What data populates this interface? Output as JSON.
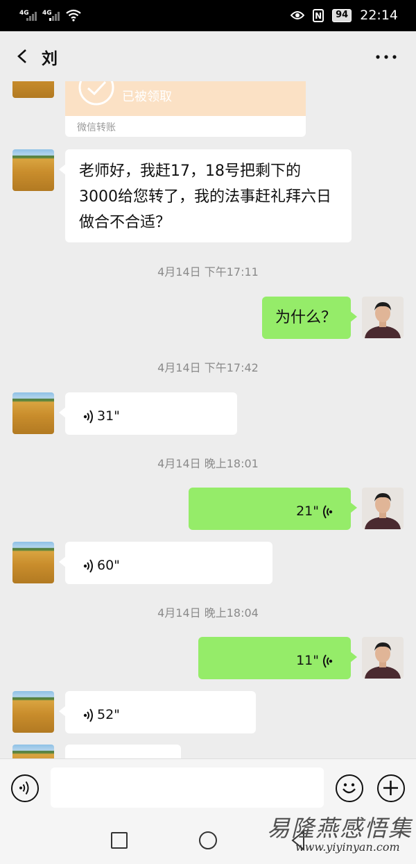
{
  "status_bar": {
    "signal1": "4G",
    "signal2": "4G",
    "battery": "94",
    "time": "22:14",
    "nfc": "N"
  },
  "header": {
    "title": "刘"
  },
  "transfer": {
    "status": "已被领取",
    "label": "微信转账"
  },
  "messages": {
    "m1_text": "老师好，我赶17，18号把剩下的3000给您转了，我的法事赶礼拜六日做合不合适？",
    "t1": "4月14日 下午17:11",
    "m2_text": "为什么？",
    "t2": "4月14日 下午17:42",
    "m3_duration": "31\"",
    "t3": "4月14日 晚上18:01",
    "m4_duration": "21\"",
    "m5_duration": "60\"",
    "t4": "4月14日 晚上18:04",
    "m6_duration": "11\"",
    "m7_duration": "52\""
  },
  "watermark": {
    "title": "易隆燕感悟集",
    "url": "www.yiyinyan.com"
  },
  "colors": {
    "outgoing_bubble": "#95ec69",
    "incoming_bubble": "#ffffff",
    "background": "#ededed"
  }
}
